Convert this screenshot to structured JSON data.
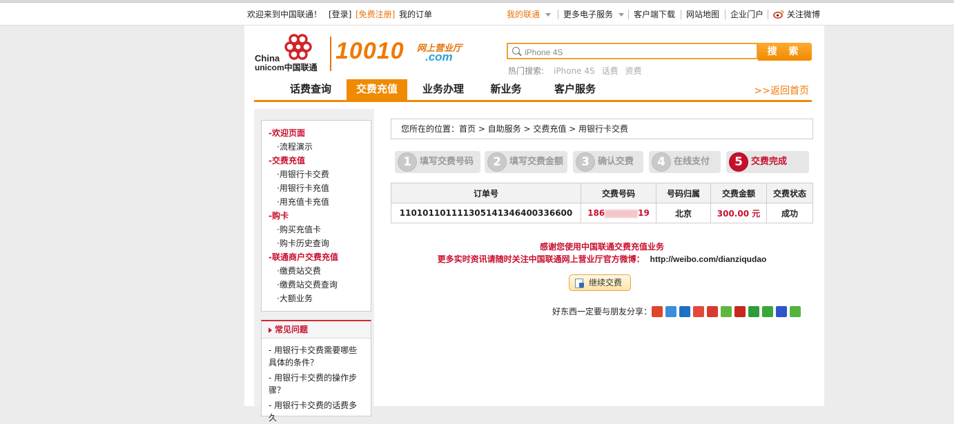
{
  "topbar": {
    "welcome": "欢迎来到中国联通！",
    "login": "[登录]",
    "register": "[免费注册]",
    "my_orders": "我的订单",
    "my_unicom": "我的联通",
    "more_services": "更多电子服务",
    "client_download": "客户端下载",
    "sitemap": "网站地图",
    "enterprise": "企业门户",
    "weibo": "关注微博"
  },
  "logo": {
    "cn_text": "China",
    "cn_text2": "unicom中国联通",
    "brand_number": "10010",
    "brand_sub": "网上营业厅",
    "brand_domain": ".com"
  },
  "search": {
    "value": "iPhone 4S",
    "button_label": "搜 索",
    "hot_label": "热门搜索:",
    "hot_terms": [
      "iPhone 4S",
      "话费",
      "资费"
    ]
  },
  "nav": {
    "items": [
      "话费查询",
      "交费充值",
      "业务办理",
      "新业务",
      "客户服务"
    ],
    "active_index": 1,
    "back_home": ">>返回首页"
  },
  "sidebar": {
    "rows": [
      {
        "text": "-欢迎页面",
        "kind": "head"
      },
      {
        "text": "·流程演示",
        "kind": "sub"
      },
      {
        "text": "-交费充值",
        "kind": "head"
      },
      {
        "text": "·用银行卡交费",
        "kind": "sub"
      },
      {
        "text": "·用银行卡充值",
        "kind": "sub"
      },
      {
        "text": "·用充值卡充值",
        "kind": "sub"
      },
      {
        "text": "-购卡",
        "kind": "head"
      },
      {
        "text": "·购买充值卡",
        "kind": "sub"
      },
      {
        "text": "·购卡历史查询",
        "kind": "sub"
      },
      {
        "text": "-联通商户交费充值",
        "kind": "head"
      },
      {
        "text": "·缴费站交费",
        "kind": "sub"
      },
      {
        "text": "·缴费站交费查询",
        "kind": "sub"
      },
      {
        "text": "·大额业务",
        "kind": "sub"
      }
    ],
    "faq_title": "常见问题",
    "faq_items": [
      "- 用银行卡交费需要哪些具体的条件？",
      "- 用银行卡交费的操作步骤？",
      "- 用银行卡交费的话费多久"
    ]
  },
  "breadcrumb": "您所在的位置：首页 > 自助服务 > 交费充值 > 用银行卡交费",
  "steps": [
    {
      "num": "1",
      "label": "填写交费号码",
      "done": false
    },
    {
      "num": "2",
      "label": "填写交费金额",
      "done": false
    },
    {
      "num": "3",
      "label": "确认交费",
      "done": false
    },
    {
      "num": "4",
      "label": "在线支付",
      "done": false
    },
    {
      "num": "5",
      "label": "交费完成",
      "done": true
    }
  ],
  "result_table": {
    "headers": [
      "订单号",
      "交费号码",
      "号码归属",
      "交费金额",
      "交费状态"
    ],
    "row": {
      "order_no": "1101011011113051413464003366​00",
      "phone_prefix": "186",
      "phone_suffix": "19",
      "region": "北京",
      "amount": "300.00 元",
      "status": "成功"
    }
  },
  "message": {
    "thanks": "感谢您使用中国联通交费充值业务",
    "follow": "更多实时资讯请随时关注中国联通网上营业厅官方微博：",
    "weibo_url": "http://weibo.com/dianziqudao"
  },
  "continue_button": "继续交费",
  "share_label": "好东西一定要与朋友分享：",
  "share_icons": [
    {
      "name": "sina-weibo-icon",
      "color": "#e0442a"
    },
    {
      "name": "qzone-icon",
      "color": "#3a8fd8"
    },
    {
      "name": "renren-icon",
      "color": "#1f6fc5"
    },
    {
      "name": "kaixin-icon",
      "color": "#e24a3b"
    },
    {
      "name": "tencent-weibo-icon",
      "color": "#d93a2e"
    },
    {
      "name": "pengyou-icon",
      "color": "#5fb63f"
    },
    {
      "name": "t163-icon",
      "color": "#c9261f"
    },
    {
      "name": "douban-icon",
      "color": "#2f9c3a"
    },
    {
      "name": "clover-icon",
      "color": "#3aa63a"
    },
    {
      "name": "baidu-icon",
      "color": "#2f55c9"
    },
    {
      "name": "more-share-icon",
      "color": "#55b43e"
    }
  ]
}
